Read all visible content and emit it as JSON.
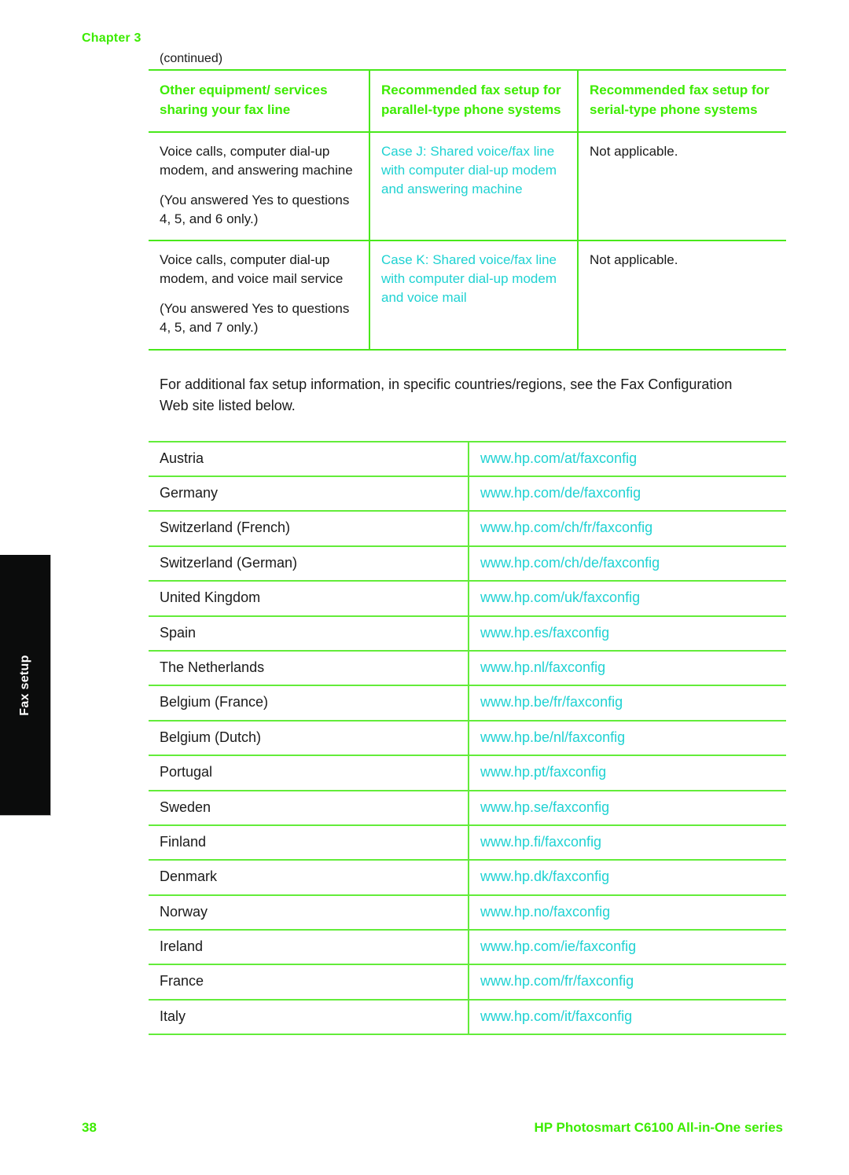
{
  "page": {
    "chapter_label": "Chapter 3",
    "continued_label": "(continued)",
    "side_tab_label": "Fax setup",
    "page_number": "38",
    "footer_title": "HP Photosmart C6100 All-in-One series",
    "accent_green": "#3CEB00",
    "rule_green": "#49E81B",
    "link_cyan": "#1FD2D2",
    "tab_background": "#0b0c0c",
    "text_color": "#1a1a1a"
  },
  "cases_table": {
    "headers": [
      "Other equipment/ services sharing your fax line",
      "Recommended fax setup for parallel-type phone systems",
      "Recommended fax setup for serial-type phone systems"
    ],
    "rows": [
      {
        "equipment_line_1": "Voice calls, computer dial-up modem, and answering machine",
        "equipment_line_2": "(You answered Yes to questions 4, 5, and 6 only.)",
        "parallel": "Case J: Shared voice/fax line with computer dial-up modem and answering machine",
        "serial": "Not applicable."
      },
      {
        "equipment_line_1": "Voice calls, computer dial-up modem, and voice mail service",
        "equipment_line_2": "(You answered Yes to questions 4, 5, and 7 only.)",
        "parallel": "Case K: Shared voice/fax line with computer dial-up modem and voice mail",
        "serial": "Not applicable."
      }
    ]
  },
  "intro_paragraph": "For additional fax setup information, in specific countries/regions, see the Fax Configuration Web site listed below.",
  "country_table": {
    "rows": [
      {
        "country": "Austria",
        "url": "www.hp.com/at/faxconfig"
      },
      {
        "country": "Germany",
        "url": "www.hp.com/de/faxconfig"
      },
      {
        "country": "Switzerland (French)",
        "url": "www.hp.com/ch/fr/faxconfig"
      },
      {
        "country": "Switzerland (German)",
        "url": "www.hp.com/ch/de/faxconfig"
      },
      {
        "country": "United Kingdom",
        "url": "www.hp.com/uk/faxconfig"
      },
      {
        "country": "Spain",
        "url": "www.hp.es/faxconfig"
      },
      {
        "country": "The Netherlands",
        "url": "www.hp.nl/faxconfig"
      },
      {
        "country": "Belgium (France)",
        "url": "www.hp.be/fr/faxconfig"
      },
      {
        "country": "Belgium (Dutch)",
        "url": "www.hp.be/nl/faxconfig"
      },
      {
        "country": "Portugal",
        "url": "www.hp.pt/faxconfig"
      },
      {
        "country": "Sweden",
        "url": "www.hp.se/faxconfig"
      },
      {
        "country": "Finland",
        "url": "www.hp.fi/faxconfig"
      },
      {
        "country": "Denmark",
        "url": "www.hp.dk/faxconfig"
      },
      {
        "country": "Norway",
        "url": "www.hp.no/faxconfig"
      },
      {
        "country": "Ireland",
        "url": "www.hp.com/ie/faxconfig"
      },
      {
        "country": "France",
        "url": "www.hp.com/fr/faxconfig"
      },
      {
        "country": "Italy",
        "url": "www.hp.com/it/faxconfig"
      }
    ]
  }
}
